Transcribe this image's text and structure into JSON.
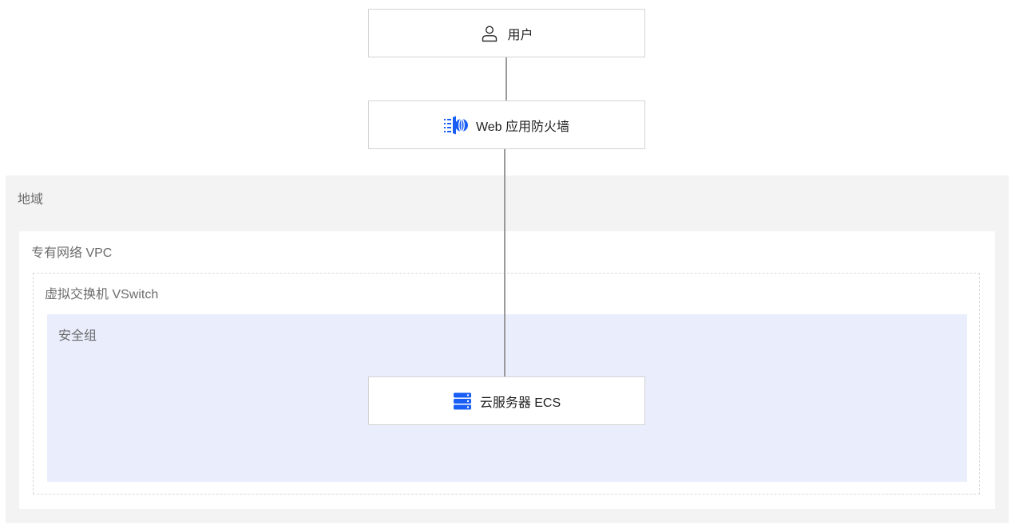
{
  "nodes": {
    "user": {
      "label": "用户",
      "icon": "user-icon"
    },
    "waf": {
      "label": "Web 应用防火墙",
      "icon": "web-firewall-icon"
    },
    "ecs": {
      "label": "云服务器 ECS",
      "icon": "server-icon"
    }
  },
  "containers": {
    "region": {
      "label": "地域"
    },
    "vpc": {
      "label": "专有网络 VPC"
    },
    "vswitch": {
      "label": "虚拟交换机 VSwitch"
    },
    "security_group": {
      "label": "安全组"
    }
  },
  "colors": {
    "region_bg": "#f3f3f3",
    "vpc_bg": "#ffffff",
    "security_group_bg": "#e9edfc",
    "icon_blue": "#1a5ff5",
    "connector": "#9a9a9a",
    "node_border": "#d4d4d4"
  }
}
